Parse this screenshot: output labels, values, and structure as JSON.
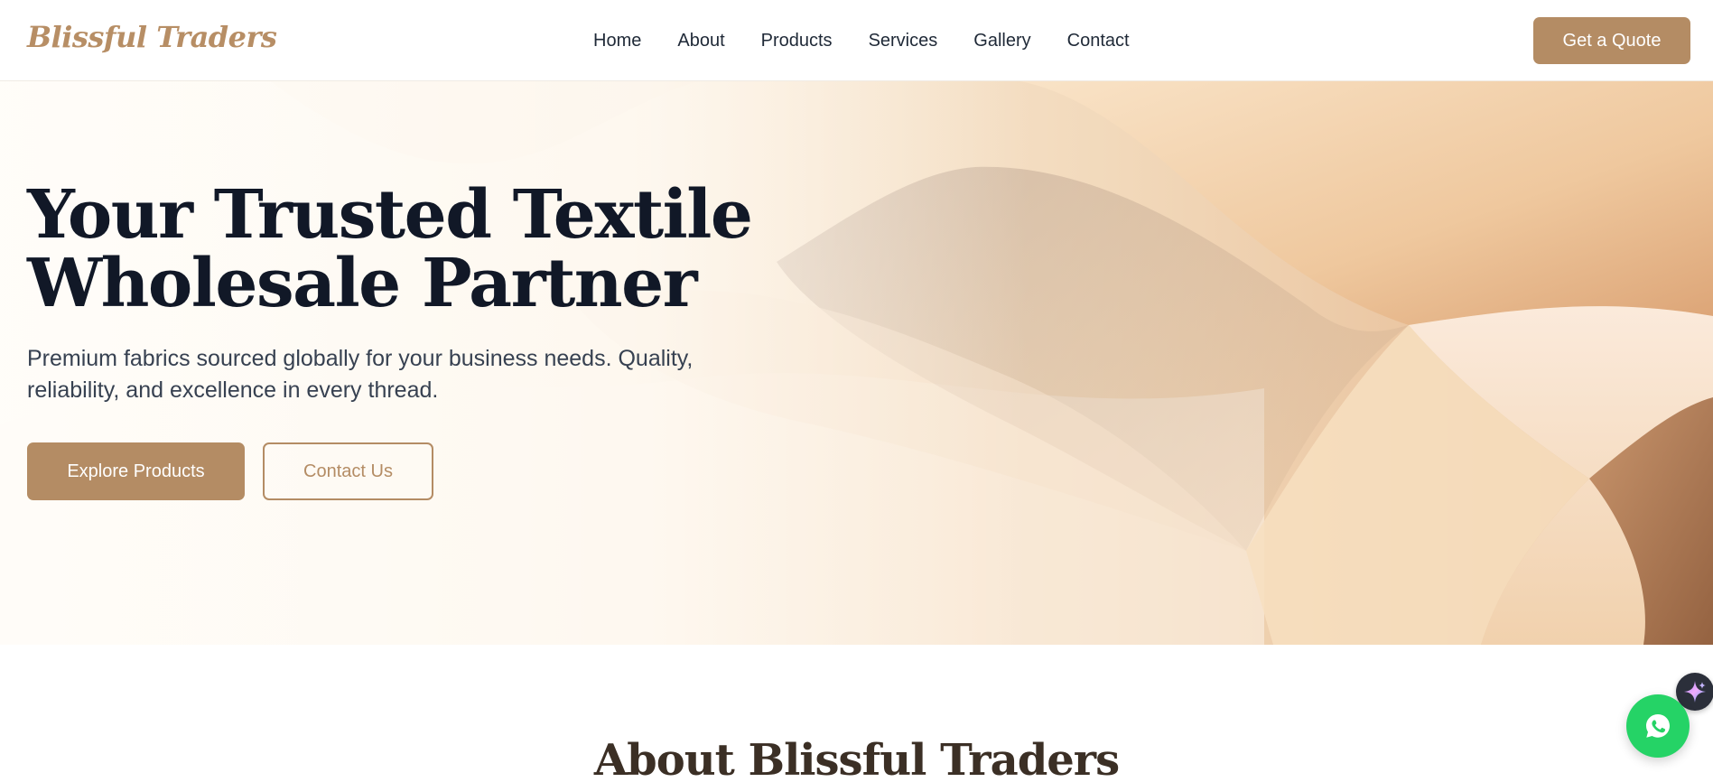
{
  "header": {
    "logo": "Blissful Traders",
    "nav": [
      "Home",
      "About",
      "Products",
      "Services",
      "Gallery",
      "Contact"
    ],
    "cta_label": "Get a Quote"
  },
  "hero": {
    "title_line1": "Your Trusted Textile",
    "title_line2": "Wholesale Partner",
    "subtitle_line1": "Premium fabrics sourced globally for your business needs. Quality,",
    "subtitle_line2": "reliability, and excellence in every thread.",
    "primary_button": "Explore Products",
    "secondary_button": "Contact Us"
  },
  "about": {
    "title": "About Blissful Traders"
  },
  "widgets": {
    "ai_icon": "sparkle-icon",
    "chat_icon": "whatsapp-icon"
  },
  "colors": {
    "accent": "#b48c64",
    "heading": "#111827",
    "whatsapp": "#25d366"
  }
}
